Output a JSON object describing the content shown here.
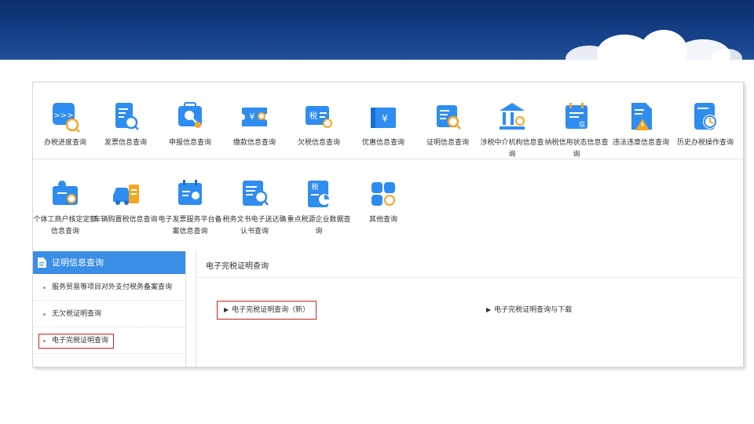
{
  "icons_row1": [
    {
      "label": "办税进度查询",
      "icon": "clock-search-icon"
    },
    {
      "label": "发票信息查询",
      "icon": "invoice-search-icon"
    },
    {
      "label": "申报信息查询",
      "icon": "declaration-search-icon"
    },
    {
      "label": "缴款信息查询",
      "icon": "payment-ticket-icon"
    },
    {
      "label": "欠税信息查询",
      "icon": "tax-arrears-icon"
    },
    {
      "label": "优惠信息查询",
      "icon": "discount-coupon-icon"
    },
    {
      "label": "证明信息查询",
      "icon": "certificate-search-icon"
    },
    {
      "label": "涉税中介机构信息查询",
      "icon": "bank-building-icon"
    },
    {
      "label": "纳税信用状态信息查询",
      "icon": "credit-calendar-icon"
    },
    {
      "label": "违法违章信息查询",
      "icon": "warning-document-icon"
    },
    {
      "label": "历史办税操作查询",
      "icon": "history-clock-icon"
    }
  ],
  "icons_row2": [
    {
      "label": "个体工商户核定定额信息查询",
      "icon": "business-license-icon"
    },
    {
      "label": "车辆购置税信息查询",
      "icon": "car-icon"
    },
    {
      "label": "电子发票服务平台备案信息查询",
      "icon": "calendar-record-icon"
    },
    {
      "label": "税务文书电子送达确认书查询",
      "icon": "document-search-icon"
    },
    {
      "label": "重点税源企业数据查询",
      "icon": "tax-chart-icon"
    },
    {
      "label": "其他查询",
      "icon": "grid-apps-icon"
    }
  ],
  "sidebar": {
    "title": "证明信息查询",
    "items": [
      {
        "label": "服务贸易等项目对外支付税务备案查询"
      },
      {
        "label": "无欠税证明查询"
      },
      {
        "label": "电子完税证明查询"
      }
    ]
  },
  "content": {
    "title": "电子完税证明查询",
    "links": [
      {
        "label": "电子完税证明查询（新）"
      },
      {
        "label": "电子完税证明查询与下载"
      }
    ],
    "triangle": "▶"
  },
  "colors": {
    "accent": "#3a8ee6",
    "icon_blue": "#2f8cf0",
    "highlight": "#d42020",
    "banner": "#153f86"
  }
}
